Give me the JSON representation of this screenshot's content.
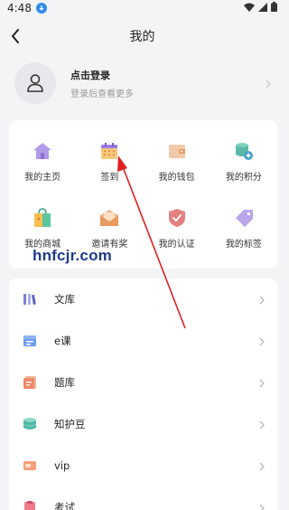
{
  "status_bar": {
    "time": "4:48"
  },
  "nav": {
    "title": "我的"
  },
  "login": {
    "title": "点击登录",
    "subtitle": "登录后查看更多"
  },
  "grid": [
    {
      "label": "我的主页",
      "icon": "home-icon"
    },
    {
      "label": "签到",
      "icon": "calendar-icon"
    },
    {
      "label": "我的钱包",
      "icon": "wallet-icon"
    },
    {
      "label": "我的积分",
      "icon": "points-icon"
    },
    {
      "label": "我的商城",
      "icon": "shop-bag-icon"
    },
    {
      "label": "邀请有奖",
      "icon": "invite-envelope-icon"
    },
    {
      "label": "我的认证",
      "icon": "shield-icon"
    },
    {
      "label": "我的标签",
      "icon": "tag-icon"
    }
  ],
  "watermark": "hnfcjr.com",
  "list": [
    {
      "label": "文库",
      "icon": "library-icon"
    },
    {
      "label": "e课",
      "icon": "course-icon"
    },
    {
      "label": "题库",
      "icon": "question-bank-icon"
    },
    {
      "label": "知护豆",
      "icon": "coin-stack-icon"
    },
    {
      "label": "vip",
      "icon": "vip-card-icon"
    },
    {
      "label": "考试",
      "icon": "exam-icon"
    }
  ],
  "colors": {
    "background": "#f4f4f6",
    "card": "#ffffff",
    "accent_purple": "#9b7fe0",
    "accent_orange": "#f0a060",
    "arrow": "#e02020"
  }
}
